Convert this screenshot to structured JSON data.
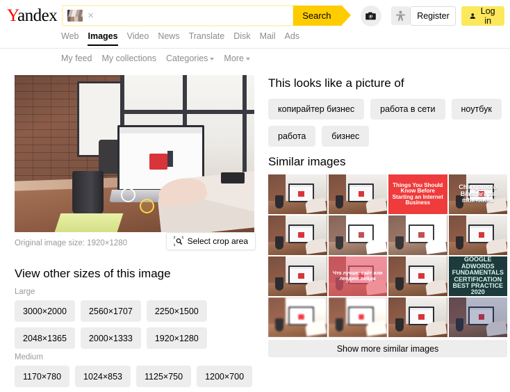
{
  "brand": {
    "logo_first": "Y",
    "logo_rest": "andex",
    "logo_accent": "#ff0000"
  },
  "search": {
    "value": "",
    "placeholder": "",
    "button_label": "Search",
    "clear_label": "×",
    "thumb_name": "query-image-thumbnail"
  },
  "header_actions": {
    "camera_icon": "camera-search-icon",
    "person_icon": "accessibility-person-icon",
    "register_label": "Register",
    "login_label": "Log in",
    "login_bg": "#fce85b"
  },
  "nav": {
    "items": [
      {
        "label": "Web",
        "active": false
      },
      {
        "label": "Images",
        "active": true
      },
      {
        "label": "Video",
        "active": false
      },
      {
        "label": "News",
        "active": false
      },
      {
        "label": "Translate",
        "active": false
      },
      {
        "label": "Disk",
        "active": false
      },
      {
        "label": "Mail",
        "active": false
      },
      {
        "label": "Ads",
        "active": false
      }
    ]
  },
  "subnav": {
    "items": [
      {
        "label": "My feed",
        "caret": false
      },
      {
        "label": "My collections",
        "caret": false
      },
      {
        "label": "Categories",
        "caret": true
      },
      {
        "label": "More",
        "caret": true
      }
    ]
  },
  "preview": {
    "original_size_label": "Original image size: 1920×1280",
    "crop_button_label": "Select crop area",
    "crop_icon": "crop-area-icon",
    "markers": [
      "object-marker-mug",
      "object-marker-cup"
    ]
  },
  "sizes": {
    "title": "View other sizes of this image",
    "groups": [
      {
        "label": "Large",
        "items": [
          "3000×2000",
          "2560×1707",
          "2250×1500",
          "2048×1365",
          "2000×1333",
          "1920×1280"
        ]
      },
      {
        "label": "Medium",
        "items": [
          "1170×780",
          "1024×853",
          "1125×750",
          "1200×700"
        ]
      }
    ]
  },
  "looks_like": {
    "title": "This looks like a picture of",
    "tags": [
      "копирайтер бизнес",
      "работа в сети",
      "ноутбук",
      "работа",
      "бизнес"
    ]
  },
  "similar": {
    "title": "Similar images",
    "show_more_label": "Show more similar images",
    "thumbs": [
      {
        "style": "plain",
        "overlay": ""
      },
      {
        "style": "plain",
        "overlay": ""
      },
      {
        "style": "red",
        "overlay": "Things You Should Know Before Starting an Internet Business"
      },
      {
        "style": "text-white",
        "overlay": "Changamoto Biashara za mtandaoni"
      },
      {
        "style": "plain",
        "overlay": ""
      },
      {
        "style": "light",
        "overlay": ""
      },
      {
        "style": "light",
        "overlay": ""
      },
      {
        "style": "plain",
        "overlay": ""
      },
      {
        "style": "plain",
        "overlay": ""
      },
      {
        "style": "pink",
        "overlay": "Что лучше: сайт или лендинг пейдж"
      },
      {
        "style": "plain",
        "overlay": ""
      },
      {
        "style": "dark",
        "overlay": "GOOGLE ADWORDS FUNDAMENTALS CERTIFICATION BEST PRACTICE 2020"
      },
      {
        "style": "blur",
        "overlay": ""
      },
      {
        "style": "blur",
        "overlay": ""
      },
      {
        "style": "plain",
        "overlay": ""
      },
      {
        "style": "blue",
        "overlay": ""
      }
    ]
  }
}
